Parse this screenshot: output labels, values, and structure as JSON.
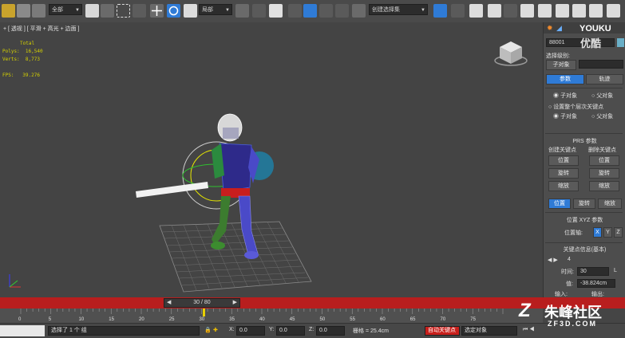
{
  "toolbar": {
    "selection_filter": "全部",
    "coord_system": "局部",
    "named_selection": "创建选择集"
  },
  "viewport": {
    "label": "+ [ 透视 ] [ 平滑 + 高光 + 边面 ]",
    "stats_total": "Total",
    "stats_polys": "Polys:  16,540",
    "stats_verts": "Verts:  8,773",
    "stats_fps": "FPS:   39.276"
  },
  "panel": {
    "object_name": "88001",
    "sel_level_label": "选择级别:",
    "sub_object": "子对象",
    "tab_params": "参数",
    "tab_trajectory": "轨迹",
    "radio_sub_object": "子对象",
    "radio_parent": "父对象",
    "set_pivot_keys": "设置整个层次关键点",
    "prs_title": "PRS 参数",
    "create_key": "创建关键点",
    "delete_key": "删除关键点",
    "position": "位置",
    "rotation": "旋转",
    "scale": "缩放",
    "pos_xyz_title": "位置 XYZ 参数",
    "pos_axis_label": "位置轴:",
    "axis_x": "X",
    "axis_y": "Y",
    "axis_z": "Z",
    "key_info_title": "关键点信息(基本)",
    "key_index": "4",
    "time_label": "时间:",
    "time_value": "30",
    "lock_l": "L",
    "value_label": "值:",
    "value_value": "-38.824cm",
    "in_label": "输入:",
    "out_label": "输出:"
  },
  "timeline": {
    "frame_display": "30 / 80",
    "ticks": [
      "0",
      "5",
      "10",
      "15",
      "20",
      "25",
      "30",
      "35",
      "40",
      "45",
      "50",
      "55",
      "60",
      "65",
      "70",
      "75"
    ]
  },
  "status": {
    "message": "选择了 1 个 组",
    "x_label": "X:",
    "x_value": "0.0",
    "y_label": "Y:",
    "y_value": "0.0",
    "z_label": "Z:",
    "z_value": "0.0",
    "grid": "栅格 = 25.4cm",
    "autokey": "自动关键点",
    "selected_object": "选定对象"
  },
  "watermarks": {
    "youku": "YOUKU",
    "youku_cn": "优酷",
    "zhufeng": "朱峰社区",
    "zf3d": "ZF3D.COM"
  },
  "colors": {
    "accent_blue": "#2f7bd6",
    "timeline_red": "#b81e1e",
    "autokey_red": "#c8201c",
    "stats_yellow": "#d6d200"
  }
}
